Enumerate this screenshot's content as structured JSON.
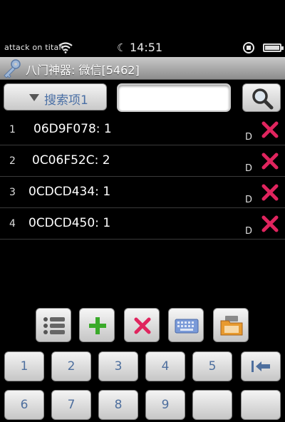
{
  "status_bar": {
    "carrier": "attack on titan",
    "time": "14:51"
  },
  "title_bar": {
    "title": "八门神器: 微信[5462]"
  },
  "search": {
    "dropdown_label": "搜索项1",
    "input_value": "",
    "input_placeholder": ""
  },
  "results": [
    {
      "index": "1",
      "code": "06D9F078: 1",
      "type": "D"
    },
    {
      "index": "2",
      "code": "0C06F52C: 2",
      "type": "D"
    },
    {
      "index": "3",
      "code": "0CDCD434: 1",
      "type": "D"
    },
    {
      "index": "4",
      "code": "0CDCD450: 1",
      "type": "D"
    }
  ],
  "toolbar": {
    "icons": [
      "list-icon",
      "add-icon",
      "delete-icon",
      "keyboard-icon",
      "folder-icon"
    ]
  },
  "keypad": {
    "row1": [
      "1",
      "2",
      "3",
      "4",
      "5"
    ],
    "row2": [
      "6",
      "7",
      "8",
      "9"
    ]
  },
  "colors": {
    "delete_red": "#e0245e",
    "add_green": "#3aaa2a",
    "key_text": "#4e6f9e"
  }
}
